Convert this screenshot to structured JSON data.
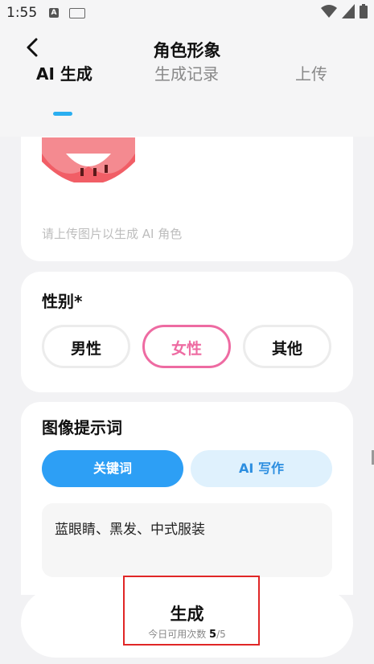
{
  "status_bar": {
    "time": "1:55",
    "icons": [
      "a-icon",
      "keyboard-icon",
      "wifi-icon",
      "signal-icon",
      "battery-icon"
    ]
  },
  "header": {
    "title": "角色形象"
  },
  "tabs": [
    {
      "label": "AI 生成",
      "active": true
    },
    {
      "label": "生成记录",
      "active": false
    },
    {
      "label": "上传",
      "active": false
    }
  ],
  "upload": {
    "hint": "请上传图片以生成 AI 角色"
  },
  "gender": {
    "title": "性别*",
    "options": [
      "男性",
      "女性",
      "其他"
    ],
    "selected": "女性"
  },
  "prompt": {
    "title": "图像提示词",
    "mode_buttons": [
      "关键词",
      "AI 写作"
    ],
    "value": "蓝眼睛、黑发、中式服装"
  },
  "generate": {
    "label": "生成",
    "quota_prefix": "今日可用次数",
    "quota_used": "5",
    "quota_total": "/5"
  },
  "colors": {
    "accent": "#2d9ff5",
    "selected": "#ee6ba2",
    "highlight": "#e02626"
  }
}
